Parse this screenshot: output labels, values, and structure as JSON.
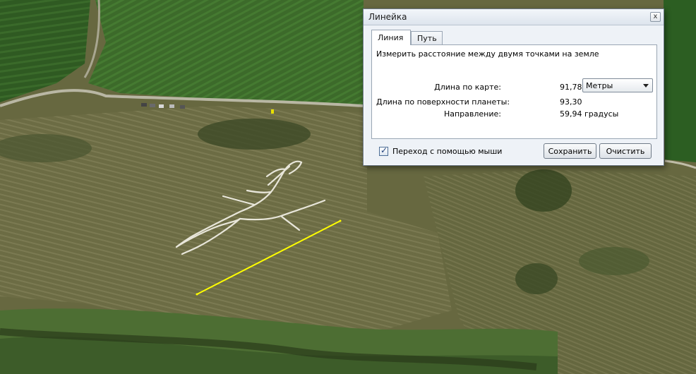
{
  "dialog": {
    "title": "Линейка",
    "close_glyph": "x",
    "tabs": [
      {
        "label": "Линия",
        "active": true
      },
      {
        "label": "Путь",
        "active": false
      }
    ],
    "description": "Измерить расстояние между двумя точками на земле",
    "map_length": {
      "label": "Длина по карте:",
      "value": "91,78"
    },
    "unit_select": {
      "value": "Метры"
    },
    "ground_length": {
      "label": "Длина по поверхности планеты:",
      "value": "93,30"
    },
    "heading": {
      "label": "Направление:",
      "value": "59,94 градусы"
    },
    "mouse_nav": {
      "label": "Переход с помощью мыши",
      "checked": true,
      "check_glyph": "✓"
    },
    "save_label": "Сохранить",
    "clear_label": "Очистить"
  },
  "colors": {
    "measure_line": "#ffff00",
    "figure_outline": "#e8e6da",
    "dialog_bg": "#eef2f7"
  }
}
